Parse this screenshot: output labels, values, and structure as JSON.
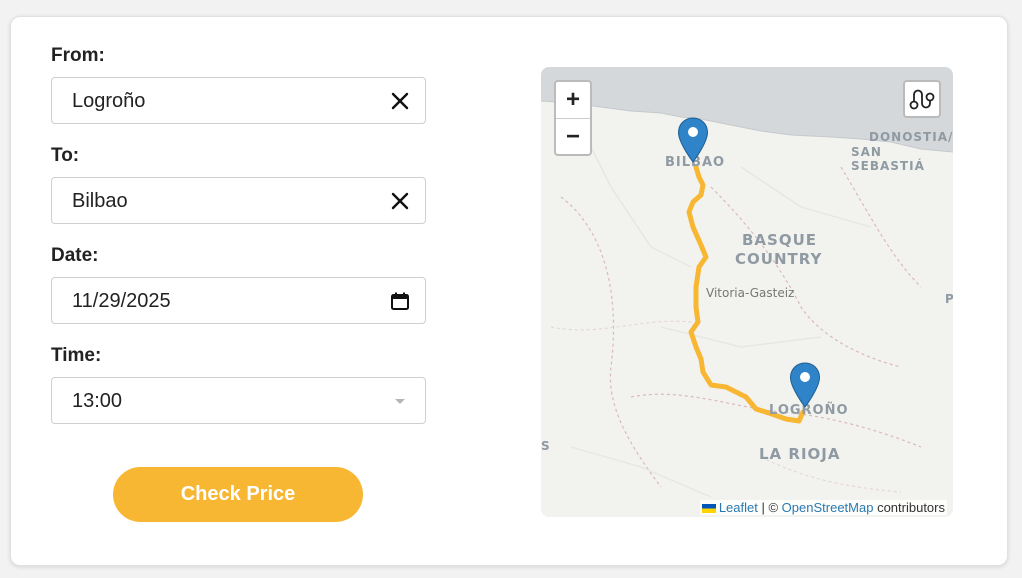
{
  "form": {
    "from_label": "From:",
    "from_value": "Logroño",
    "to_label": "To:",
    "to_value": "Bilbao",
    "date_label": "Date:",
    "date_value": "11/29/2025",
    "time_label": "Time:",
    "time_value": "13:00",
    "submit_label": "Check Price"
  },
  "map": {
    "zoom_in": "+",
    "zoom_out": "−",
    "labels": {
      "bilbao": "BILBAO",
      "donostia": "DONOSTIA/",
      "san_sebastian": "SAN SEBASTIÁ",
      "basque_1": "BASQUE",
      "basque_2": "COUNTRY",
      "vitoria": "Vitoria-Gasteiz",
      "logrono": "LOGROÑO",
      "la_rioja": "LA RIOJA",
      "edge_p": "P",
      "edge_s": "S"
    },
    "attribution": {
      "leaflet": "Leaflet",
      "separator": " | © ",
      "osm": "OpenStreetMap",
      "suffix": " contributors"
    },
    "icons": {
      "marker": "map-marker-icon",
      "route": "route-icon",
      "clear": "close-icon",
      "calendar": "calendar-icon",
      "dropdown": "chevron-down-icon"
    }
  },
  "colors": {
    "accent": "#f8b733",
    "route": "#f8b733",
    "marker": "#2f84c9",
    "sea": "#d4d8db",
    "land": "#f2f2ef"
  }
}
